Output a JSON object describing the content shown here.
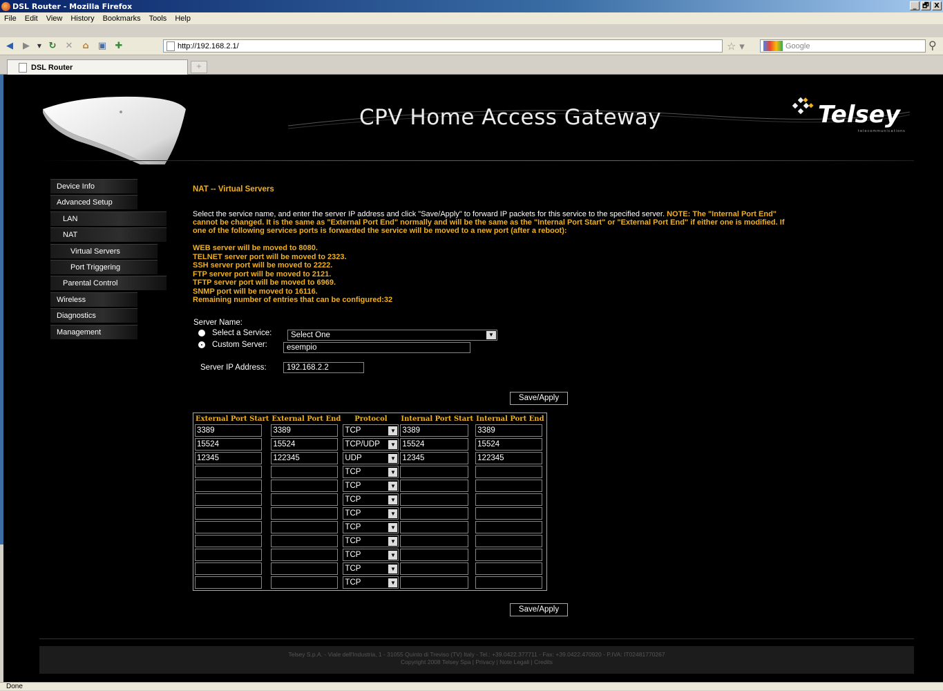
{
  "window": {
    "title": "DSL Router - Mozilla Firefox",
    "minimize": "_",
    "restore": "🗗",
    "close": "X"
  },
  "menu": [
    "File",
    "Edit",
    "View",
    "History",
    "Bookmarks",
    "Tools",
    "Help"
  ],
  "nav": {
    "url": "http://192.168.2.1/",
    "search_placeholder": "Google"
  },
  "tab": {
    "title": "DSL Router"
  },
  "header": {
    "title": "CPV Home Access Gateway",
    "logo": "Telsey",
    "logo_sub": "telecommunications"
  },
  "sidebar": {
    "items": [
      {
        "label": "Device Info",
        "level": 1
      },
      {
        "label": "Advanced Setup",
        "level": 1
      },
      {
        "label": "LAN",
        "level": 2
      },
      {
        "label": "NAT",
        "level": 2
      },
      {
        "label": "Virtual Servers",
        "level": 3
      },
      {
        "label": "Port Triggering",
        "level": 3
      },
      {
        "label": "Parental Control",
        "level": 2
      },
      {
        "label": "Wireless",
        "level": 1
      },
      {
        "label": "Diagnostics",
        "level": 1
      },
      {
        "label": "Management",
        "level": 1
      }
    ]
  },
  "main": {
    "title": "NAT -- Virtual Servers",
    "desc_plain": "Select the service name, and enter the server IP address and click \"Save/Apply\" to forward IP packets for this service to the specified server. ",
    "desc_bold_1": "NOTE: The \"Internal Port End\"",
    "desc_bold_2": "cannot be changed. It is the same as \"External Port End\" normally and will be the same as the \"Internal Port Start\" or \"External Port End\" if either one is modified. If",
    "desc_bold_3": "one of the following services ports is forwarded the service will be moved to a new port (after a reboot):",
    "notes": [
      "WEB server will be moved to 8080.",
      "TELNET server port will be moved to 2323.",
      "SSH server port will be moved to 2222.",
      "FTP server port will be moved to 2121.",
      "TFTP server port will be moved to 6969.",
      "SNMP port will be moved to 16116.",
      "Remaining number of entries that can be configured:32"
    ],
    "server_name_label": "Server Name:",
    "select_service_label": "Select a Service:",
    "select_service_value": "Select One",
    "custom_server_label": "Custom Server:",
    "custom_server_value": "esempio",
    "server_ip_label": "Server IP Address:",
    "server_ip_value": "192.168.2.2",
    "save_label": "Save/Apply"
  },
  "table": {
    "headers": [
      "External Port Start",
      "External Port End",
      "Protocol",
      "Internal Port Start",
      "Internal Port End"
    ],
    "rows": [
      [
        "3389",
        "3389",
        "TCP",
        "3389",
        "3389"
      ],
      [
        "15524",
        "15524",
        "TCP/UDP",
        "15524",
        "15524"
      ],
      [
        "12345",
        "122345",
        "UDP",
        "12345",
        "122345"
      ],
      [
        "",
        "",
        "TCP",
        "",
        ""
      ],
      [
        "",
        "",
        "TCP",
        "",
        ""
      ],
      [
        "",
        "",
        "TCP",
        "",
        ""
      ],
      [
        "",
        "",
        "TCP",
        "",
        ""
      ],
      [
        "",
        "",
        "TCP",
        "",
        ""
      ],
      [
        "",
        "",
        "TCP",
        "",
        ""
      ],
      [
        "",
        "",
        "TCP",
        "",
        ""
      ],
      [
        "",
        "",
        "TCP",
        "",
        ""
      ],
      [
        "",
        "",
        "TCP",
        "",
        ""
      ]
    ]
  },
  "footer": {
    "line1": "Telsey S.p.A. - Viale dell'Industria, 1 - 31055 Quinto di Treviso (TV) Italy - Tel.: +39.0422.377711 - Fax: +39.0422.470920 - P.IVA: IT02481770267",
    "line2": "Copyright 2008 Telsey Spa | Privacy | Note Legali | Credits"
  },
  "status": {
    "text": "Done"
  }
}
